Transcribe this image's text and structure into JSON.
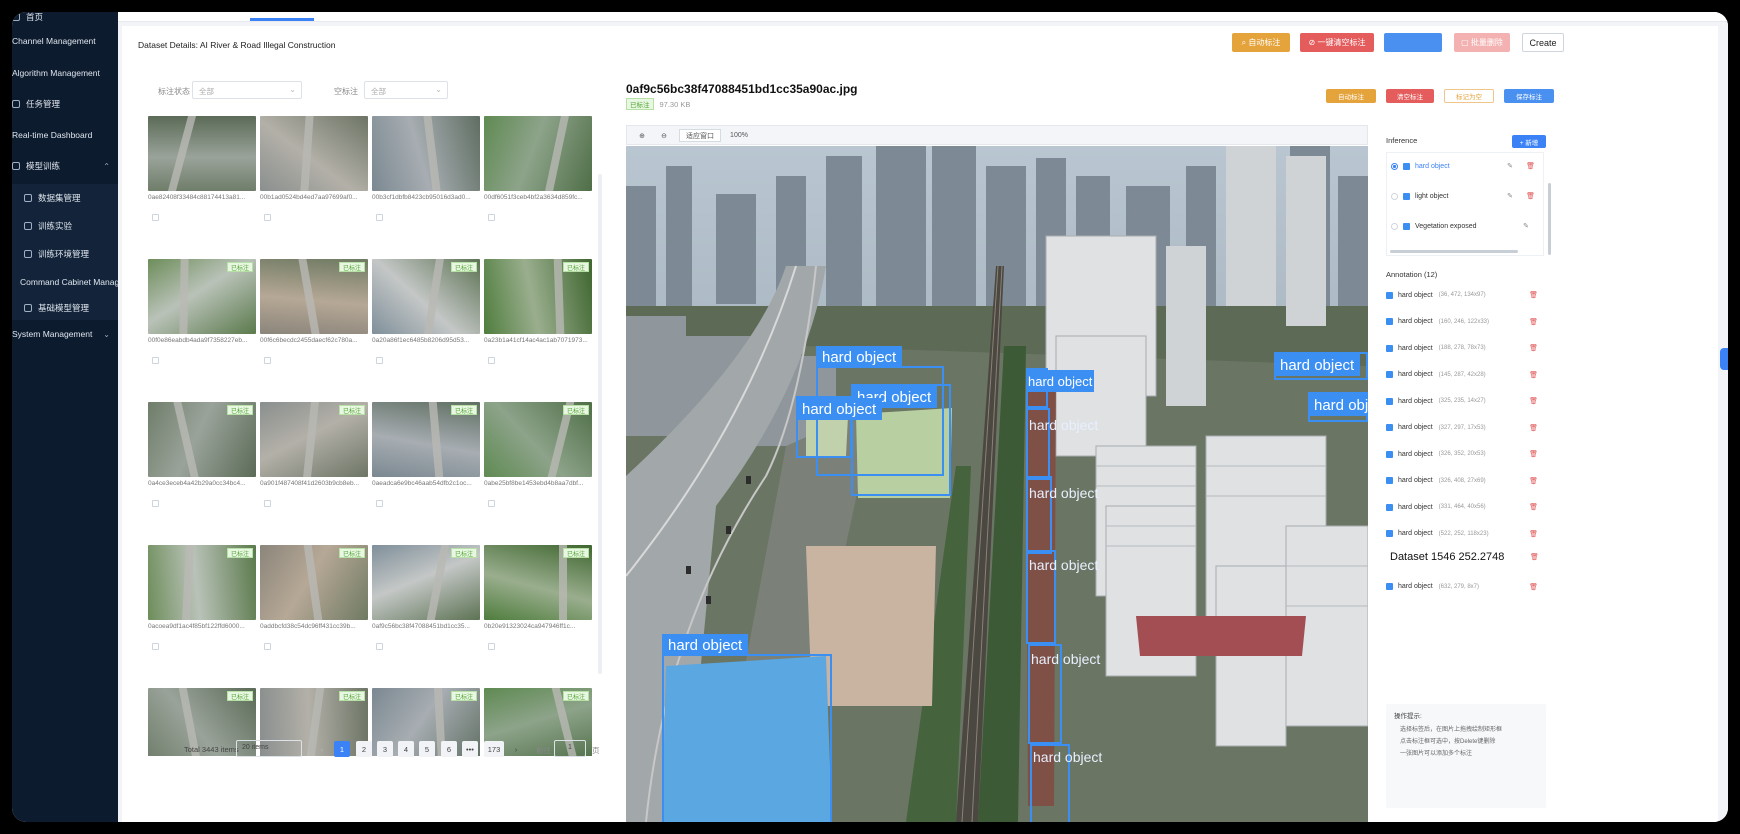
{
  "sidebar": {
    "items": [
      {
        "label": "首页"
      },
      {
        "label": "Channel Management"
      },
      {
        "label": "Algorithm Management"
      },
      {
        "label": "任务管理"
      },
      {
        "label": "Real-time Dashboard"
      },
      {
        "label": "模型训练"
      },
      {
        "label": "数据集管理"
      },
      {
        "label": "训练实验"
      },
      {
        "label": "训练环境管理"
      },
      {
        "label": "Command Cabinet Management"
      },
      {
        "label": "基础模型管理"
      },
      {
        "label": "System Management"
      }
    ]
  },
  "header": {
    "title": "Dataset Details: AI River & Road Illegal Construction",
    "buttons": {
      "auto_label": "自动标注",
      "clear_empty": "一键清空标注",
      "blank": "",
      "batch_delete": "批量删除",
      "create": "Create"
    }
  },
  "filters": {
    "label_status_label": "标注状态",
    "label_status_value": "全部",
    "empty_label_label": "空标注",
    "empty_label_value": "全部"
  },
  "images": [
    {
      "name": "0ae82408f33484c88174413a81...",
      "badge": ""
    },
    {
      "name": "00b1ad0524bd4ed7aa97699af0...",
      "badge": ""
    },
    {
      "name": "00b3cf1dbfb8423cb95016d3ad0...",
      "badge": ""
    },
    {
      "name": "00df6051f3ceb4bf2a3634d859fc...",
      "badge": ""
    },
    {
      "name": "00f0e86eabdb4ada9f7358227eb...",
      "badge": "已标注"
    },
    {
      "name": "00f6c6becdc2455daecf62c780a...",
      "badge": "已标注"
    },
    {
      "name": "0a20a86f1ec6485b8206d95d53...",
      "badge": "已标注"
    },
    {
      "name": "0a23b1a41cf14ac4ac1ab7071973...",
      "badge": "已标注"
    },
    {
      "name": "0a4ce3eceb4a42b29a0cc34bc4...",
      "badge": "已标注"
    },
    {
      "name": "0a901f487408f41d2603b9cb8eb...",
      "badge": "已标注"
    },
    {
      "name": "0aeadca6e9bc46aab54dfb2c1oc...",
      "badge": "已标注"
    },
    {
      "name": "0abe25bf8be1453ebd4b8aa7dbf...",
      "badge": "已标注"
    },
    {
      "name": "0acoea9df1ac4f85bf122ffd6000...",
      "badge": "已标注"
    },
    {
      "name": "0addbcfd38c54dc96ff431cc39b...",
      "badge": "已标注"
    },
    {
      "name": "0af9c56bc38f47088451bd1cc35...",
      "badge": "已标注"
    },
    {
      "name": "0b20e91323024ca947946ff1c...",
      "badge": "已标注"
    },
    {
      "name": "",
      "badge": "已标注"
    },
    {
      "name": "",
      "badge": "已标注"
    },
    {
      "name": "",
      "badge": "已标注"
    },
    {
      "name": "",
      "badge": "已标注"
    }
  ],
  "pagination": {
    "total": "Total 3443 items",
    "page_size": "20 items",
    "pages": [
      "1",
      "2",
      "3",
      "4",
      "5",
      "6",
      "•••",
      "173"
    ],
    "current": "1",
    "prev": "‹",
    "next": "›",
    "goto_label": "前往",
    "goto_value": "1",
    "page_suffix": "页"
  },
  "detail": {
    "filename": "0af9c56bc38f47088451bd1cc35a90ac.jpg",
    "status_badge": "已标注",
    "size": "97.30 KB",
    "buttons": {
      "auto": "自动标注",
      "clear": "清空标注",
      "mark_empty": "标记为空",
      "save": "保存标注"
    },
    "toolbar": {
      "zoom_in": "⊕",
      "zoom_out": "⊖",
      "fit": "适应窗口",
      "zoom": "100%"
    },
    "boxes": [
      {
        "label": "hard object"
      },
      {
        "label": "hard object"
      },
      {
        "label": "hard object"
      },
      {
        "label": "hard object"
      },
      {
        "label": "hard object"
      },
      {
        "label": "hard object"
      },
      {
        "label": "hard object"
      },
      {
        "label": "hard object"
      },
      {
        "label": "hard object"
      },
      {
        "label": "hard object"
      },
      {
        "label": "hard object"
      },
      {
        "label": "hard object"
      }
    ]
  },
  "inference": {
    "title": "Inference",
    "add_label": "+ 新增",
    "items": [
      {
        "label": "hard object",
        "selected": true
      },
      {
        "label": "light object",
        "selected": false
      },
      {
        "label": "Vegetation exposed",
        "selected": false
      }
    ]
  },
  "annotations": {
    "title": "Annotation (12)",
    "items": [
      {
        "label": "hard object",
        "coords": "(36, 472, 134x97)"
      },
      {
        "label": "hard object",
        "coords": "(160, 246, 122x33)"
      },
      {
        "label": "hard object",
        "coords": "(188, 278, 78x73)"
      },
      {
        "label": "hard object",
        "coords": "(145, 287, 42x28)"
      },
      {
        "label": "hard object",
        "coords": "(325, 235, 14x27)"
      },
      {
        "label": "hard object",
        "coords": "(327, 297, 17x53)"
      },
      {
        "label": "hard object",
        "coords": "(326, 352, 20x53)"
      },
      {
        "label": "hard object",
        "coords": "(326, 408, 27x69)"
      },
      {
        "label": "hard object",
        "coords": "(331, 464, 40x56)"
      },
      {
        "label": "hard object",
        "coords": "(522, 252, 118x23)"
      },
      {
        "label": "Dataset 1546 252.2748",
        "coords": ""
      },
      {
        "label": "hard object",
        "coords": "(632, 279, 8x7)"
      }
    ]
  },
  "tips": {
    "title": "操作提示:",
    "lines": [
      "选择标签后，在图片上拖拽绘制矩形框",
      "点击标注框可选中，按Delete键删除",
      "一张图片可以添加多个标注"
    ]
  },
  "colors": {
    "sidebar_bg": "#0d1b2e",
    "accent": "#3b82f6",
    "box": "#3b8ff2",
    "orange": "#e5a33b",
    "red": "#e45c5c"
  }
}
